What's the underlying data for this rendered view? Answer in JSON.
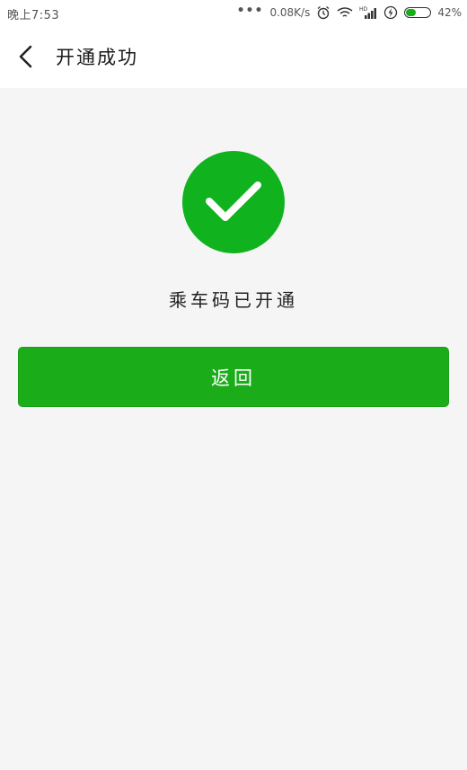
{
  "status_bar": {
    "time": "晚上7:53",
    "dots": "•••",
    "network_speed": "0.08K/s",
    "battery_percent": "42%",
    "battery_level": 0.42,
    "hd_badge": "HD",
    "icons": [
      "alarm-icon",
      "wifi-icon",
      "signal-icon",
      "charging-icon",
      "battery-icon"
    ]
  },
  "nav": {
    "title": "开通成功",
    "back_icon": "chevron-left-icon"
  },
  "main": {
    "success_icon": "checkmark-icon",
    "message": "乘车码已开通",
    "return_button_label": "返回"
  },
  "colors": {
    "accent_green": "#1aad19",
    "circle_green": "#10b21e",
    "background": "#f5f5f5"
  }
}
